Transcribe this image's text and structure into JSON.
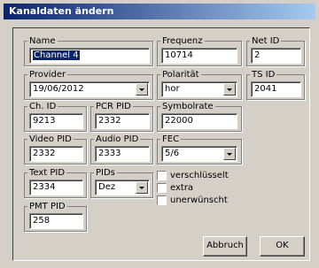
{
  "window": {
    "title": "Kanaldaten ändern"
  },
  "fields": {
    "name": {
      "label": "Name",
      "value": "Channel 4"
    },
    "frequenz": {
      "label": "Frequenz",
      "value": "10714"
    },
    "net_id": {
      "label": "Net ID",
      "value": "2"
    },
    "provider": {
      "label": "Provider",
      "value": "19/06/2012"
    },
    "polaritaet": {
      "label": "Polarität",
      "value": "hor"
    },
    "ts_id": {
      "label": "TS ID",
      "value": "2041"
    },
    "ch_id": {
      "label": "Ch. ID",
      "value": "9213"
    },
    "pcr_pid": {
      "label": "PCR PID",
      "value": "2332"
    },
    "symbolrate": {
      "label": "Symbolrate",
      "value": "22000"
    },
    "video_pid": {
      "label": "Video PID",
      "value": "2332"
    },
    "audio_pid": {
      "label": "Audio PID",
      "value": "2333"
    },
    "fec": {
      "label": "FEC",
      "value": "5/6"
    },
    "text_pid": {
      "label": "Text PID",
      "value": "2334"
    },
    "pids": {
      "label": "PIDs",
      "value": "Dez"
    },
    "pmt_pid": {
      "label": "PMT PID",
      "value": "258"
    }
  },
  "checkboxes": [
    {
      "label": "verschlüsselt",
      "checked": false
    },
    {
      "label": "extra",
      "checked": false
    },
    {
      "label": "unerwünscht",
      "checked": false
    }
  ],
  "buttons": {
    "cancel": "Abbruch",
    "ok": "OK"
  }
}
